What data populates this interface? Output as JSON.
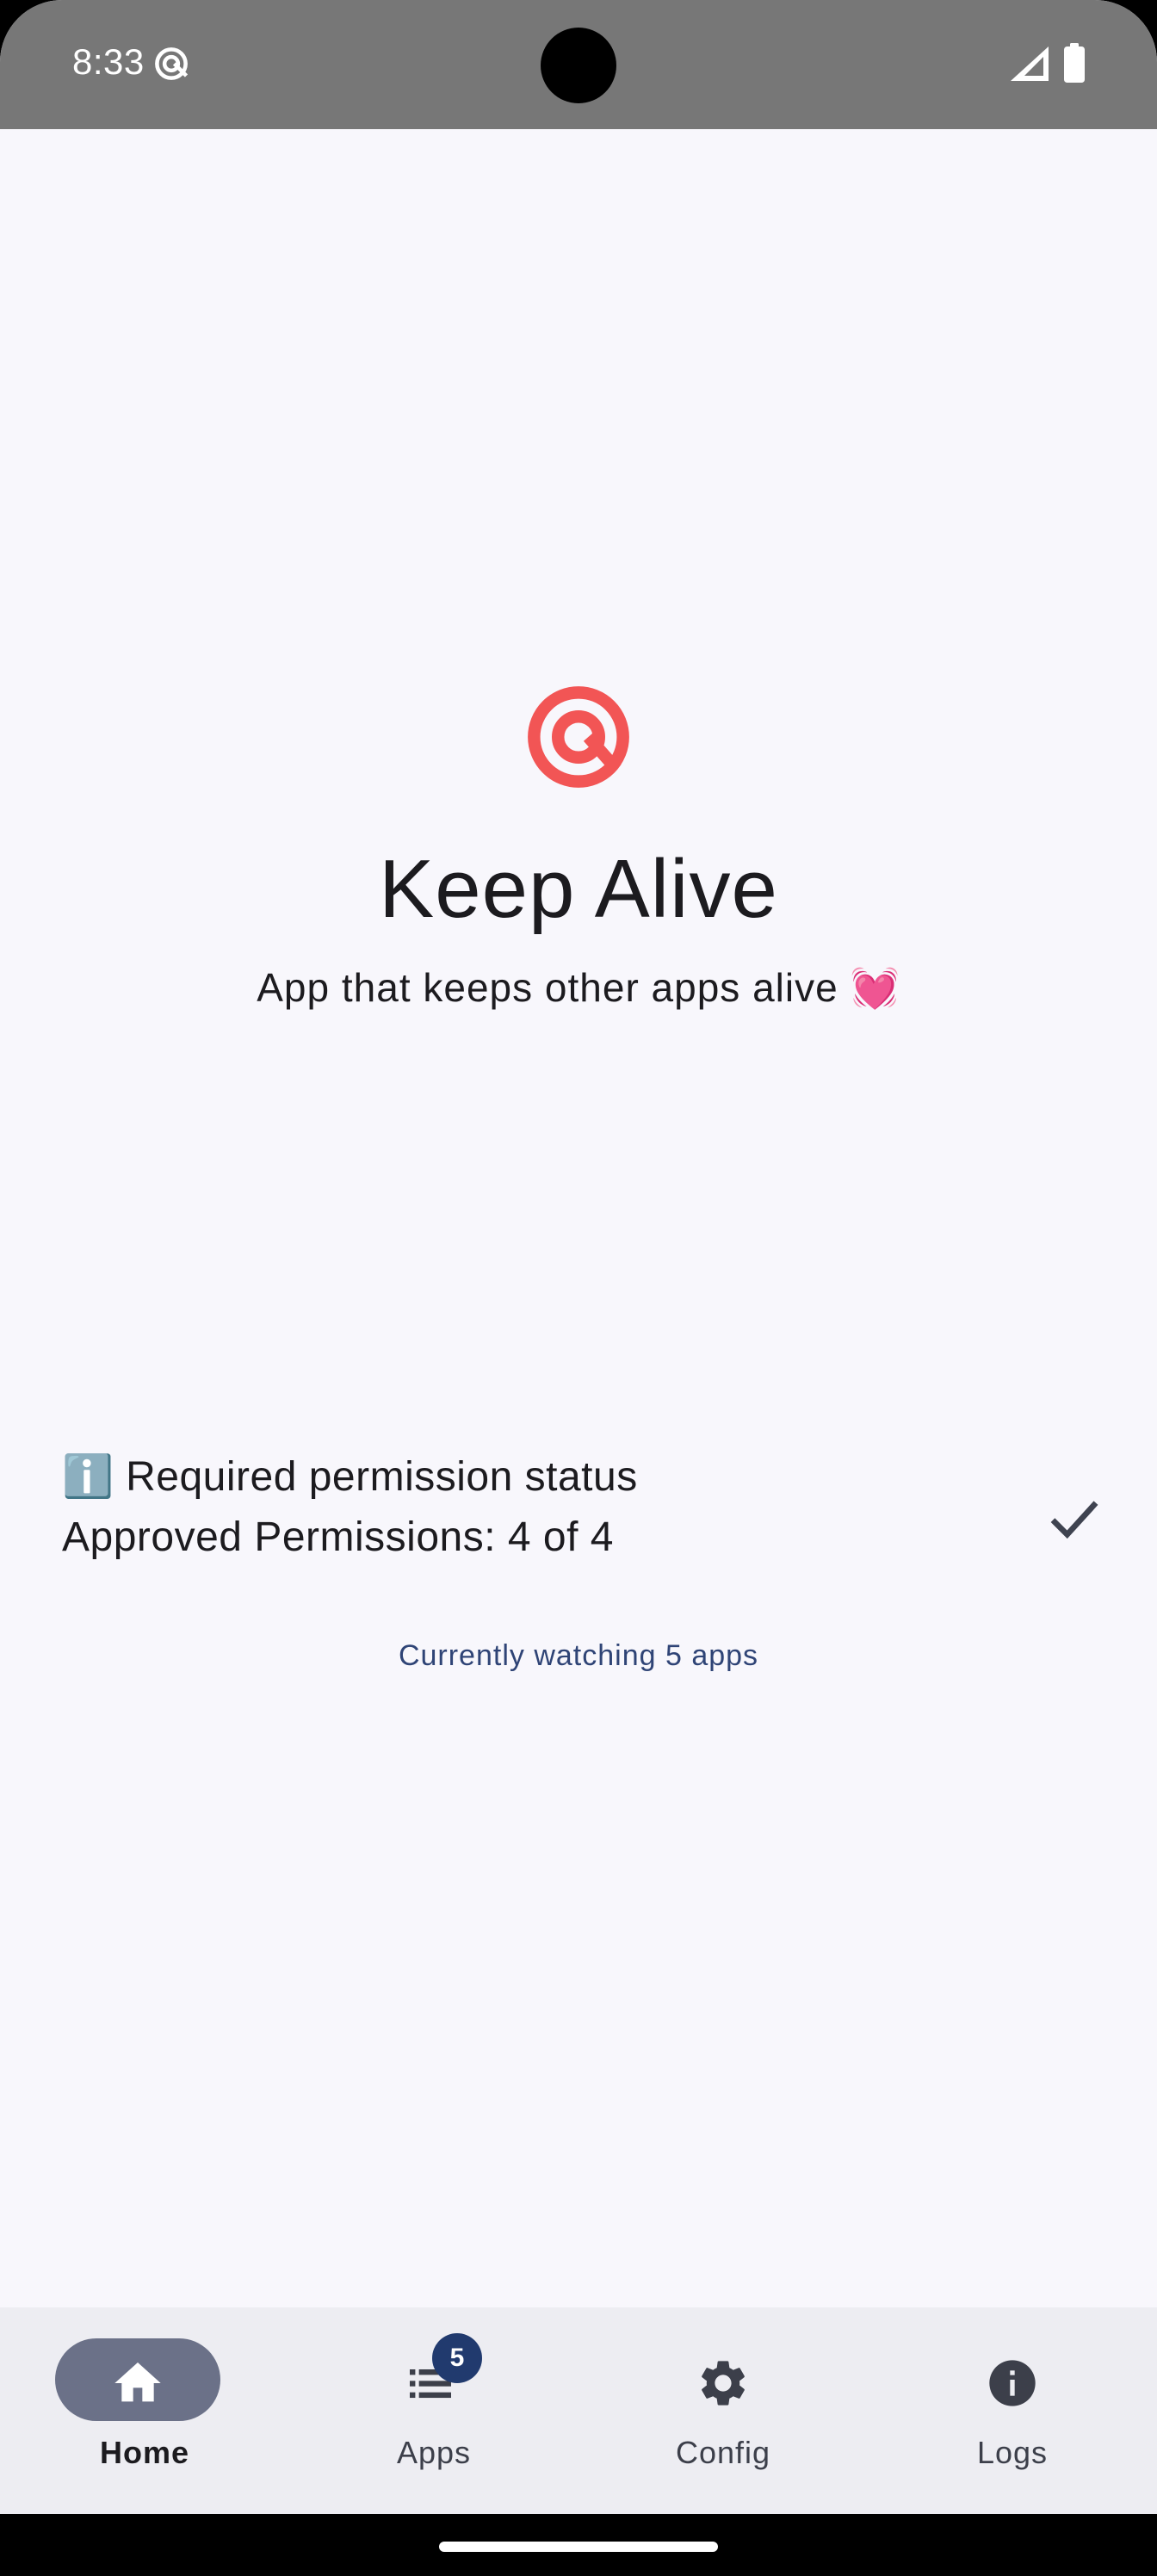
{
  "status_bar": {
    "time": "8:33",
    "app_icon": "at-target-icon",
    "signal_icon": "cell-signal-icon",
    "battery_icon": "battery-icon"
  },
  "hero": {
    "logo_icon": "keep-alive-logo-icon",
    "logo_color": "#f25555",
    "title": "Keep Alive",
    "subtitle": "App that keeps other apps alive 💓"
  },
  "permissions": {
    "title": "ℹ️ Required permission status",
    "status": "Approved Permissions: 4 of 4",
    "status_icon": "checkmark-icon"
  },
  "watching": {
    "text": "Currently watching 5 apps"
  },
  "bottom_nav": {
    "items": [
      {
        "label": "Home",
        "icon": "home-icon",
        "active": true
      },
      {
        "label": "Apps",
        "icon": "list-icon",
        "badge": "5"
      },
      {
        "label": "Config",
        "icon": "gear-icon"
      },
      {
        "label": "Logs",
        "icon": "info-icon"
      }
    ]
  },
  "colors": {
    "background": "#f8f7fc",
    "status_bar": "#777777",
    "accent_text": "#2f4476",
    "nav_active_pill": "#6b7188",
    "badge": "#213a6e"
  }
}
